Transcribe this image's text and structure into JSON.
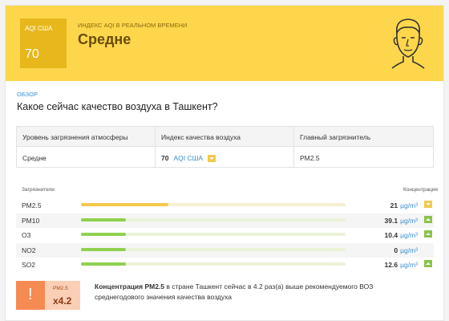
{
  "header": {
    "aqi_label": "AQI США",
    "aqi_value": "70",
    "live_label": "ИНДЕКС AQI В РЕАЛЬНОМ ВРЕМЕНИ",
    "level": "Средне",
    "icon": "person-face-icon",
    "color": "#fdd64b"
  },
  "overview": {
    "section": "ОБЗОР",
    "question": "Какое сейчас качество воздуха в Ташкент?"
  },
  "summary_table": {
    "headers": [
      "Уровень загрязнения атмосферы",
      "Индекс качества воздуха",
      "Главный загрязнитель"
    ],
    "level": "Средне",
    "aqi_number": "70",
    "aqi_unit": "AQI США",
    "main_pollutant": "PM2.5"
  },
  "pollutants": {
    "col_left": "Загрязнители",
    "col_right": "Концентрация",
    "rows": [
      {
        "name": "PM2.5",
        "value": "21",
        "unit": "µg/m³",
        "level": 0.33,
        "color": "#f2c94c",
        "trend": "down"
      },
      {
        "name": "PM10",
        "value": "39.1",
        "unit": "µg/m³",
        "level": 0.17,
        "color": "#8fd14f",
        "trend": "up"
      },
      {
        "name": "O3",
        "value": "10.4",
        "unit": "µg/m³",
        "level": 0.17,
        "color": "#8fd14f",
        "trend": "up"
      },
      {
        "name": "NO2",
        "value": "0",
        "unit": "µg/m³",
        "level": 0.17,
        "color": "#8fd14f",
        "trend": "none"
      },
      {
        "name": "SO2",
        "value": "12.6",
        "unit": "µg/m³",
        "level": 0.17,
        "color": "#8fd14f",
        "trend": "up"
      }
    ]
  },
  "warning": {
    "mark": "!",
    "pollutant": "PM2.5",
    "multiplier": "x4.2",
    "text_bold": "Концентрация PM2.5",
    "text_rest": "в стране Ташкент сейчас в 4.2 раз(а) выше рекомендуемого ВОЗ среднегодового значения качества воздуха"
  }
}
